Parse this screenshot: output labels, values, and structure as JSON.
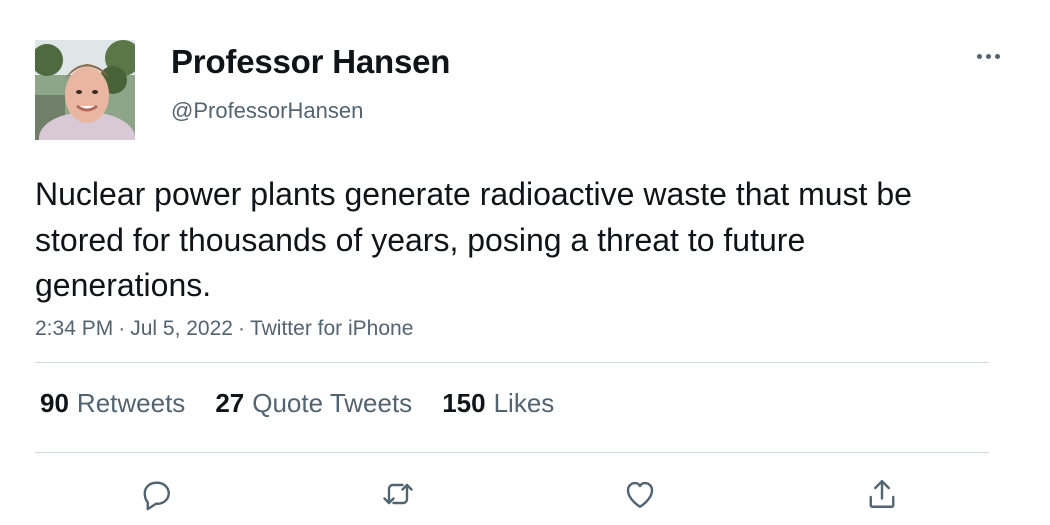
{
  "author": {
    "display_name": "Professor Hansen",
    "handle": "@ProfessorHansen",
    "avatar_icon": "profile-photo"
  },
  "tweet": {
    "text": "Nuclear power plants generate radioactive waste that must be stored for thousands of years, posing a threat to future generations.",
    "time": "2:34 PM",
    "date": "Jul 5, 2022",
    "source": "Twitter for iPhone",
    "separator": "·"
  },
  "stats": {
    "retweets": {
      "count": "90",
      "label": "Retweets"
    },
    "quotes": {
      "count": "27",
      "label": "Quote Tweets"
    },
    "likes": {
      "count": "150",
      "label": "Likes"
    }
  },
  "actions": [
    {
      "name": "reply",
      "icon": "reply-icon"
    },
    {
      "name": "retweet",
      "icon": "retweet-icon"
    },
    {
      "name": "like",
      "icon": "heart-icon"
    },
    {
      "name": "share",
      "icon": "share-icon"
    }
  ],
  "colors": {
    "text_primary": "#0f1419",
    "text_secondary": "#536471",
    "divider": "#d4d9dc"
  }
}
